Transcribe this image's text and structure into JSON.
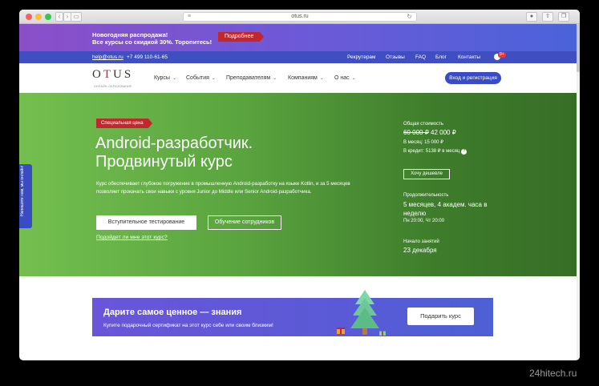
{
  "browser": {
    "url": "otus.ru"
  },
  "promo": {
    "line1": "Новогодняя распродажа!",
    "line2": "Все курсы со скидкой 30%. Торопитесь!",
    "button": "Подробнее"
  },
  "contact": {
    "email": "help@otus.ru",
    "phone": "+7 499 110-61-65",
    "links": [
      "Рекрутерам",
      "Отзывы",
      "FAQ",
      "Блог",
      "Контакты"
    ],
    "badge": "9+"
  },
  "nav": {
    "logo": "OTUS",
    "logo_sub": "ОНЛАЙН-ОБРАЗОВАНИЕ",
    "items": [
      "Курсы",
      "События",
      "Преподавателям",
      "Компаниям",
      "О нас"
    ],
    "login": "Вход и регистрация"
  },
  "hero": {
    "tag": "Специальная цена",
    "title_line1": "Android-разработчик.",
    "title_line2": "Продвинутый курс",
    "description": "Курс обеспечивает глубокое погружение в промышленную Android-разработку на языке Kotlin, и за 5 месяцев позволяет прокачать свои навыки с уровня Junior до Middle или Senior Android-разработчика.",
    "btn_test": "Вступительное тестирование",
    "btn_train": "Обучение сотрудников",
    "fit_link": "Подойдет ли мне этот курс?",
    "price_label": "Общая стоимость",
    "old_price": "60 000 ₽",
    "new_price": "42 000 ₽",
    "per_month": "В месяц: 15 000 ₽",
    "credit": "В кредит: 5138 ₽ в месяц",
    "cheaper": "Хочу дешевле",
    "duration_label": "Продолжительность",
    "duration": "5 месяцев, 4 академ. часа в неделю",
    "schedule": "Пн 20:00, Чт 20:00",
    "start_label": "Начало занятий",
    "start": "23 декабря",
    "feedback": "Напишите нам, мы онлайн!"
  },
  "gift": {
    "title": "Дарите самое ценное — знания",
    "subtitle": "Купите подарочный сертификат на этот курс себе или своим близким!",
    "button": "Подарить курс"
  },
  "watermark": "24hitech.ru",
  "colors": {
    "accent": "#3a4cc4",
    "promo_tag": "#c1272d",
    "hero_green": "#5aa43f"
  }
}
